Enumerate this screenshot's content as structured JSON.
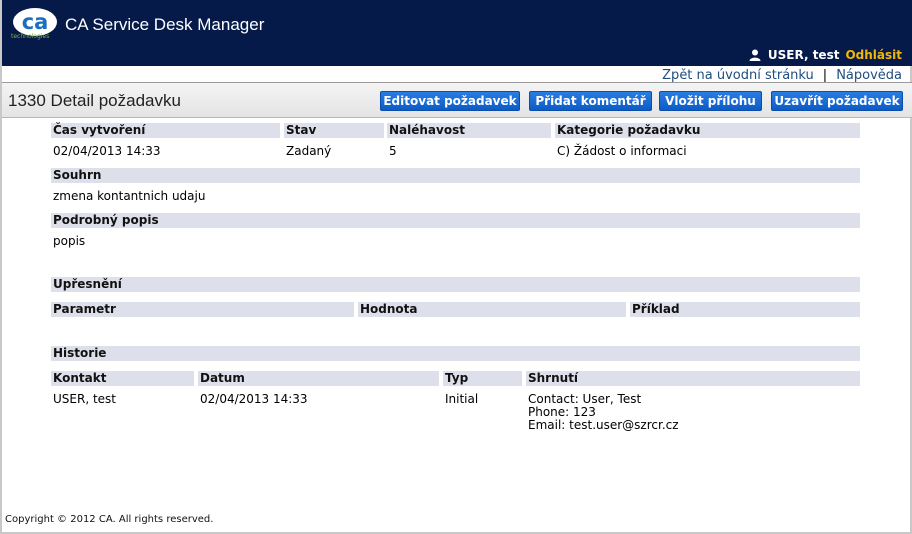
{
  "header": {
    "logo_text": "technologies",
    "app_title": "CA Service Desk Manager",
    "user_name": "USER, test",
    "logout_label": "Odhlásit"
  },
  "links": {
    "back_home": "Zpět na úvodní stránku",
    "separator": "|",
    "help": "Nápověda"
  },
  "titlebar": {
    "title": "1330 Detail požadavku",
    "buttons": [
      "Editovat požadavek",
      "Přidat komentář",
      "Vložit přílohu",
      "Uzavřít požadavek"
    ]
  },
  "details": {
    "headers": [
      "Čas vytvoření",
      "Stav",
      "Naléhavost",
      "Kategorie požadavku"
    ],
    "values": [
      "02/04/2013 14:33",
      "Zadaný",
      "5",
      "C) Žádost o informaci"
    ],
    "summary_label": "Souhrn",
    "summary_value": "zmena kontantnich udaju",
    "description_label": "Podrobný popis",
    "description_value": "popis"
  },
  "specification": {
    "label": "Upřesnění",
    "columns": [
      "Parametr",
      "Hodnota",
      "Příklad"
    ]
  },
  "history": {
    "label": "Historie",
    "columns": [
      "Kontakt",
      "Datum",
      "Typ",
      "Shrnutí"
    ],
    "rows": [
      {
        "contact": "USER, test",
        "date": "02/04/2013 14:33",
        "type": "Initial",
        "summary_lines": [
          "Contact: User, Test",
          "Phone: 123",
          "Email: test.user@szrcr.cz"
        ]
      }
    ]
  },
  "footer": {
    "copyright": "Copyright © 2012 CA. All rights reserved."
  },
  "colors": {
    "header_bg": "#061a4a",
    "logout": "#f2b705",
    "button": "#1a6ed8",
    "section_header": "#dde0ea",
    "link": "#1f4d80"
  }
}
